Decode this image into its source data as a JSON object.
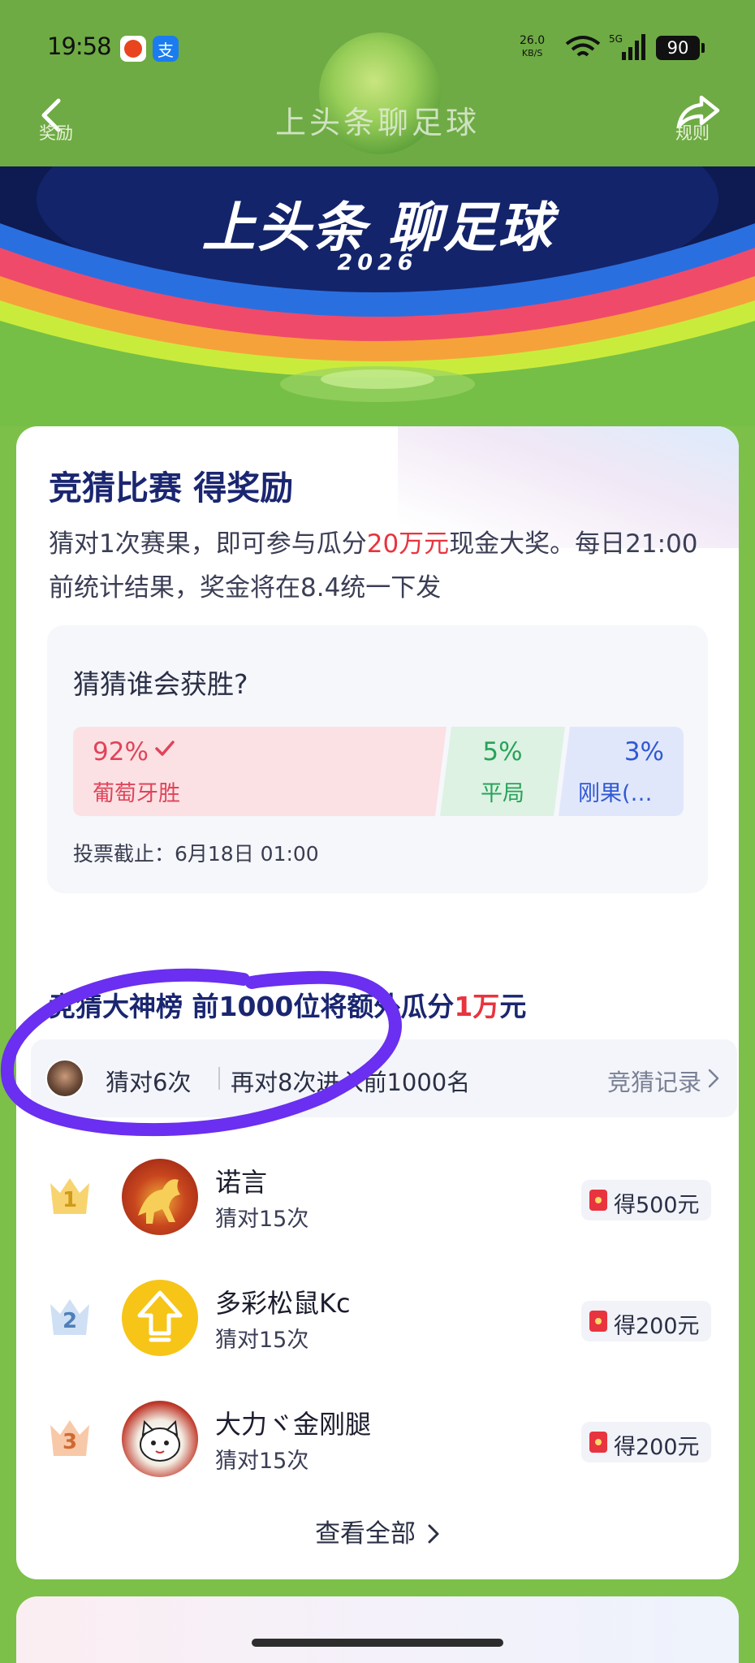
{
  "status_bar": {
    "time": "19:58",
    "app2": "支",
    "net_speed": "26.0",
    "net_unit": "KB/S",
    "signal": "5G",
    "battery": "90"
  },
  "nav": {
    "back_label": "奖励",
    "title": "上头条聊足球",
    "share_label": "规则"
  },
  "banner": {
    "title": "上头条 聊足球",
    "year": "2026"
  },
  "card": {
    "title": "竞猜比赛 得奖励",
    "desc_prefix": "猜对1次赛果，即可参与瓜分",
    "desc_highlight": "20万元",
    "desc_suffix": "现金大奖。每日21:00前统计结果，奖金将在8.4统一下发"
  },
  "poll": {
    "question": "猜猜谁会获胜?",
    "options": [
      {
        "percent": "92%",
        "label": "葡萄牙胜",
        "share": 0.92,
        "selected": true
      },
      {
        "percent": "5%",
        "label": "平局",
        "share": 0.05
      },
      {
        "percent": "3%",
        "label": "刚果(…",
        "share": 0.03
      }
    ],
    "deadline": "投票截止：6月18日 01:00"
  },
  "leaderboard": {
    "title_prefix": "竞猜大神榜 前1000位将额外瓜分",
    "title_highlight": "1万",
    "title_suffix": "元",
    "mine": {
      "count": "猜对6次",
      "next": "再对8次进入前1000名",
      "link": "竞猜记录"
    },
    "ranks": [
      {
        "rank": "1",
        "name": "诺言",
        "sub": "猜对15次",
        "prize": "得500元"
      },
      {
        "rank": "2",
        "name": "多彩松鼠Kc",
        "sub": "猜对15次",
        "prize": "得200元"
      },
      {
        "rank": "3",
        "name": "大力ヾ金刚腿",
        "sub": "猜对15次",
        "prize": "得200元"
      }
    ],
    "view_all": "查看全部"
  },
  "colors": {
    "accent_red": "#e8343f",
    "navy": "#1a2670",
    "page_green": "#7cc04a",
    "annotation_purple": "#6a2ff0"
  }
}
